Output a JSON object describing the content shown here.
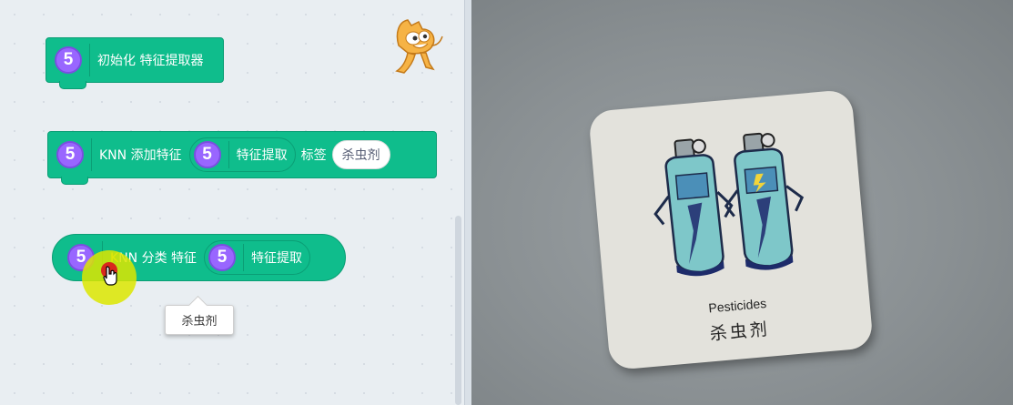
{
  "workspace": {
    "block_init": {
      "ext_badge": "5",
      "label": "初始化 特征提取器"
    },
    "block_add": {
      "ext_badge": "5",
      "label_prefix": "KNN 添加特征",
      "inner": {
        "ext_badge": "5",
        "label": "特征提取"
      },
      "label_tag": "标签",
      "tag_value": "杀虫剂"
    },
    "block_classify": {
      "ext_badge": "5",
      "label_highlight": "K",
      "label_rest": "NN 分类 特征",
      "inner": {
        "ext_badge": "5",
        "label": "特征提取"
      }
    },
    "tooltip": {
      "text": "杀虫剂"
    },
    "sprite": {
      "icon": "scratch-cat-icon"
    }
  },
  "camera": {
    "card": {
      "english": "Pesticides",
      "chinese": "杀虫剂"
    }
  },
  "colors": {
    "block_green": "#0fbd8c",
    "extension_purple": "#9966ff",
    "workspace_bg": "#e9eef2"
  }
}
